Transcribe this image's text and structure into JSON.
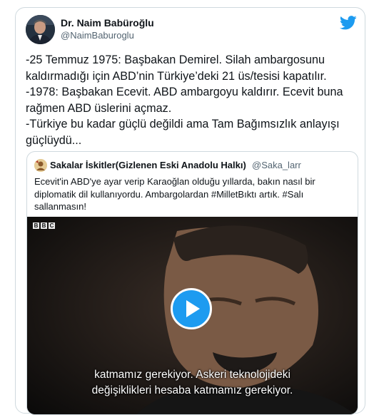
{
  "author": {
    "name": "Dr. Naim Babüroğlu",
    "handle": "@NaimBaburoglu"
  },
  "icons": {
    "brand": "twitter-bird-icon",
    "play": "play-icon"
  },
  "tweet_lines": [
    "-25 Temmuz 1975: Başbakan Demirel. Silah ambargosunu",
    "kaldırmadığı için ABD’nin Türkiye’deki 21 üs/tesisi kapatılır.",
    "-1978: Başbakan Ecevit. ABD ambargoyu kaldırır. Ecevit buna",
    "rağmen ABD üslerini açmaz.",
    "-Türkiye bu kadar güçlü değildi ama Tam Bağımsızlık anlayışı",
    "güçlüydü..."
  ],
  "quoted": {
    "name": "Sakalar İskitler(Gizlenen Eski Anadolu Halkı)",
    "handle": "@Saka_larr",
    "lines": [
      "Ecevit'in ABD'ye ayar verip Karaoğlan olduğu yıllarda, bakın  nasıl bir",
      "diplomatik dil kullanıyordu. Ambargolardan #MilletBıktı artık. #Salı",
      "sallanmasın!"
    ]
  },
  "video": {
    "logo_letters": [
      "B",
      "B",
      "C"
    ],
    "subtitle_line1": "katmamız gerekiyor. Askeri teknolojideki",
    "subtitle_line2": "değişiklikleri hesaba katmamız gerekiyor."
  },
  "colors": {
    "brand_blue": "#1d9bf0",
    "text": "#0f1419",
    "secondary": "#536471",
    "border": "#cfd9de"
  }
}
